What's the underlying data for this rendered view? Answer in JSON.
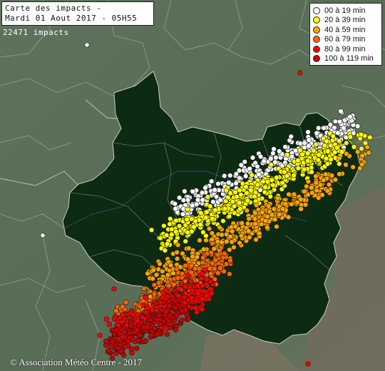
{
  "title": {
    "line1": "Carte des impacts -",
    "line2": "Mardi 01 Aout 2017 - 05H55"
  },
  "impact_count": "22471 impacts",
  "legend": [
    {
      "label": "00 à 19 min",
      "color": "#ffffff"
    },
    {
      "label": "20 à 39 min",
      "color": "#ffff00"
    },
    {
      "label": "40 à 59 min",
      "color": "#ffa500"
    },
    {
      "label": "60 à 79 min",
      "color": "#ff6600"
    },
    {
      "label": "80 à 99 min",
      "color": "#ff0000"
    },
    {
      "label": "100 à 119 min",
      "color": "#cc0000"
    }
  ],
  "copyright": "© Association Météo Centre - 2017",
  "colors": {
    "background": "#556b55",
    "region": "#0d2a12",
    "water": "#3b6fb5",
    "borders": "#9aa49a"
  }
}
